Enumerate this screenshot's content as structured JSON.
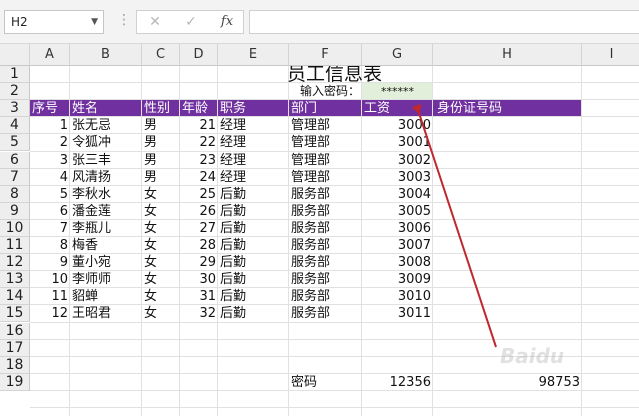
{
  "formula_bar": {
    "name_box": "H2",
    "cancel_icon": "✕",
    "confirm_icon": "✓",
    "fx_label": "fx",
    "formula_value": ""
  },
  "columns": [
    "A",
    "B",
    "C",
    "D",
    "E",
    "F",
    "G",
    "H",
    "I"
  ],
  "rows": [
    "1",
    "2",
    "3",
    "4",
    "5",
    "6",
    "7",
    "8",
    "9",
    "10",
    "11",
    "12",
    "13",
    "14",
    "15",
    "16",
    "17",
    "18",
    "19"
  ],
  "sheet": {
    "title": "员工信息表",
    "password_label": "输入密码：",
    "password_value": "******",
    "headers": [
      "序号",
      "姓名",
      "性别",
      "年龄",
      "职务",
      "部门",
      "工资",
      "身份证号码"
    ],
    "records": [
      {
        "no": "1",
        "name": "张无忌",
        "gender": "男",
        "age": "21",
        "title": "经理",
        "dept": "管理部",
        "salary": "3000"
      },
      {
        "no": "2",
        "name": "令狐冲",
        "gender": "男",
        "age": "22",
        "title": "经理",
        "dept": "管理部",
        "salary": "3001"
      },
      {
        "no": "3",
        "name": "张三丰",
        "gender": "男",
        "age": "23",
        "title": "经理",
        "dept": "管理部",
        "salary": "3002"
      },
      {
        "no": "4",
        "name": "风清扬",
        "gender": "男",
        "age": "24",
        "title": "经理",
        "dept": "管理部",
        "salary": "3003"
      },
      {
        "no": "5",
        "name": "李秋水",
        "gender": "女",
        "age": "25",
        "title": "后勤",
        "dept": "服务部",
        "salary": "3004"
      },
      {
        "no": "6",
        "name": "潘金莲",
        "gender": "女",
        "age": "26",
        "title": "后勤",
        "dept": "服务部",
        "salary": "3005"
      },
      {
        "no": "7",
        "name": "李瓶儿",
        "gender": "女",
        "age": "27",
        "title": "后勤",
        "dept": "服务部",
        "salary": "3006"
      },
      {
        "no": "8",
        "name": "梅香",
        "gender": "女",
        "age": "28",
        "title": "后勤",
        "dept": "服务部",
        "salary": "3007"
      },
      {
        "no": "9",
        "name": "董小宛",
        "gender": "女",
        "age": "29",
        "title": "后勤",
        "dept": "服务部",
        "salary": "3008"
      },
      {
        "no": "10",
        "name": "李师师",
        "gender": "女",
        "age": "30",
        "title": "后勤",
        "dept": "服务部",
        "salary": "3009"
      },
      {
        "no": "11",
        "name": "貂蝉",
        "gender": "女",
        "age": "31",
        "title": "后勤",
        "dept": "服务部",
        "salary": "3010"
      },
      {
        "no": "12",
        "name": "王昭君",
        "gender": "女",
        "age": "32",
        "title": "后勤",
        "dept": "服务部",
        "salary": "3011"
      }
    ],
    "footer": {
      "label": "密码",
      "value1": "12356",
      "value2": "98753"
    }
  },
  "colors": {
    "header_fill": "#7030a0",
    "password_fill": "#e2efda",
    "arrow": "#c0282d"
  },
  "watermark": "Baidu"
}
